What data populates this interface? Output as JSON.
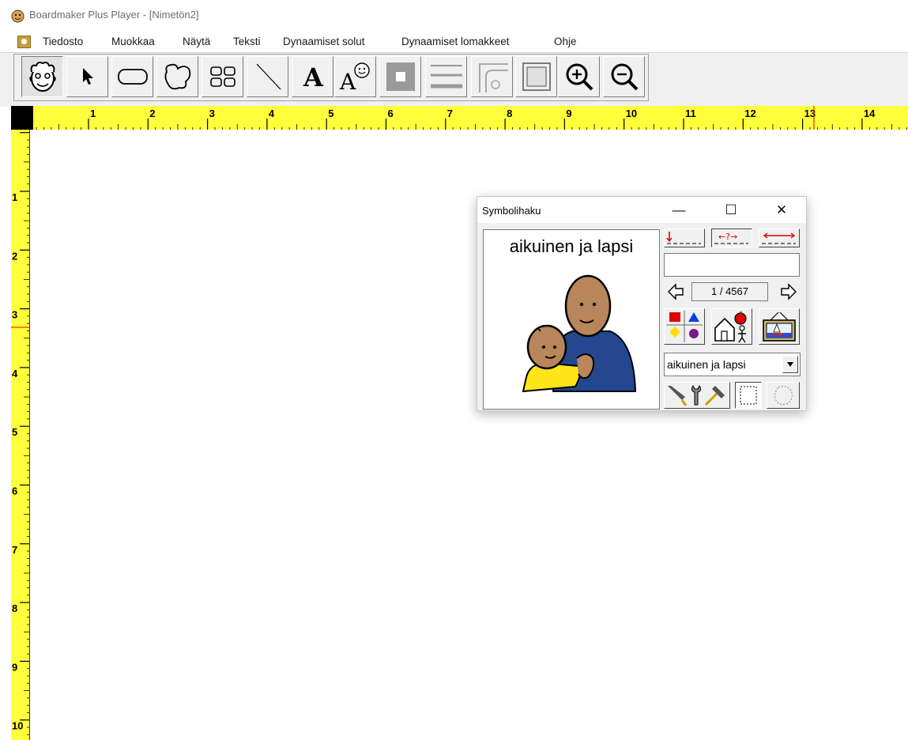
{
  "app": {
    "title": "Boardmaker Plus Player - [Nimetön2]"
  },
  "menu": {
    "items": [
      "Tiedosto",
      "Muokkaa",
      "Näytä",
      "Teksti",
      "Dynaamiset solut",
      "Dynaamiset lomakkeet",
      "Ohje"
    ]
  },
  "toolbar": {
    "tools": [
      {
        "name": "pointer-face-tool",
        "icon": "face-icon"
      },
      {
        "name": "arrow-pointer-tool",
        "icon": "arrow-pointer-icon"
      },
      {
        "name": "rounded-rect-tool",
        "icon": "rounded-rectangle-icon"
      },
      {
        "name": "freeform-tool",
        "icon": "freeform-shape-icon"
      },
      {
        "name": "cell-grid-tool",
        "icon": "grid-icon"
      },
      {
        "name": "line-tool",
        "icon": "line-icon"
      },
      {
        "name": "text-tool",
        "icon": "text-icon"
      },
      {
        "name": "symbolate-tool",
        "icon": "symbol-text-icon"
      },
      {
        "name": "fill-color-tool",
        "icon": "fill-color-icon"
      },
      {
        "name": "line-thickness-tool",
        "icon": "line-thickness-icon"
      },
      {
        "name": "corner-style-tool",
        "icon": "corner-style-icon"
      },
      {
        "name": "border-style-tool",
        "icon": "border-icon"
      },
      {
        "name": "zoom-in-tool",
        "icon": "zoom-in-icon"
      },
      {
        "name": "zoom-out-tool",
        "icon": "zoom-out-icon"
      }
    ]
  },
  "rulers": {
    "horizontal": [
      "1",
      "2",
      "3",
      "4",
      "5",
      "6",
      "7",
      "8",
      "9",
      "10",
      "11",
      "12",
      "13",
      "14"
    ],
    "vertical": [
      "1",
      "2",
      "3",
      "4",
      "5",
      "6",
      "7",
      "8",
      "9",
      "10"
    ],
    "color": "#ffff3c"
  },
  "symbol_finder": {
    "title": "Symbolihaku",
    "symbol_label": "aikuinen ja lapsi",
    "search_value": "",
    "counter": "1 / 4567",
    "combo_value": "aikuinen ja lapsi",
    "controls": {
      "minimize": "—",
      "maximize": "☐",
      "close": "✕"
    }
  }
}
